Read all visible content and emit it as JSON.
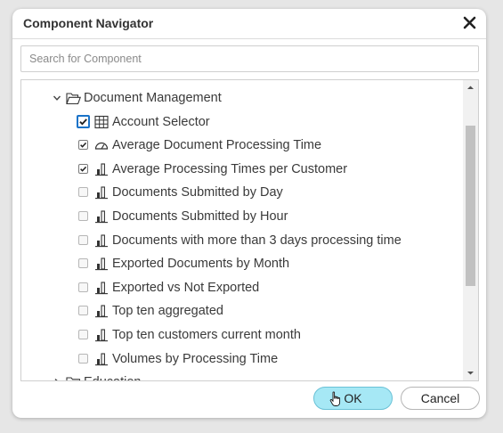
{
  "dialog": {
    "title": "Component Navigator",
    "close_icon": "close-icon"
  },
  "search": {
    "placeholder": "Search for Component",
    "value": ""
  },
  "tree": {
    "folder_open": {
      "label": "Document Management",
      "icon": "folder-open-icon",
      "expanded": true
    },
    "items": [
      {
        "label": "Account Selector",
        "icon": "table-icon",
        "checked": true,
        "focused": true
      },
      {
        "label": "Average Document Processing Time",
        "icon": "gauge-icon",
        "checked": true
      },
      {
        "label": "Average Processing Times per Customer",
        "icon": "bar-chart-icon",
        "checked": true
      },
      {
        "label": "Documents Submitted by Day",
        "icon": "bar-chart-icon",
        "checked": false
      },
      {
        "label": "Documents Submitted by Hour",
        "icon": "bar-chart-icon",
        "checked": false
      },
      {
        "label": "Documents with more than 3 days processing time",
        "icon": "bar-chart-icon",
        "checked": false
      },
      {
        "label": "Exported Documents by Month",
        "icon": "bar-chart-icon",
        "checked": false
      },
      {
        "label": "Exported vs Not Exported",
        "icon": "bar-chart-icon",
        "checked": false
      },
      {
        "label": "Top ten aggregated",
        "icon": "bar-chart-icon",
        "checked": false
      },
      {
        "label": "Top ten customers current month",
        "icon": "bar-chart-icon",
        "checked": false
      },
      {
        "label": "Volumes by Processing Time",
        "icon": "bar-chart-icon",
        "checked": false
      }
    ],
    "folder_closed": {
      "label": "Education",
      "icon": "folder-icon",
      "expanded": false
    }
  },
  "buttons": {
    "ok_label": "OK",
    "cancel_label": "Cancel"
  },
  "colors": {
    "ok_button": "#a6e8f5",
    "focus_ring": "#1a73c8"
  }
}
